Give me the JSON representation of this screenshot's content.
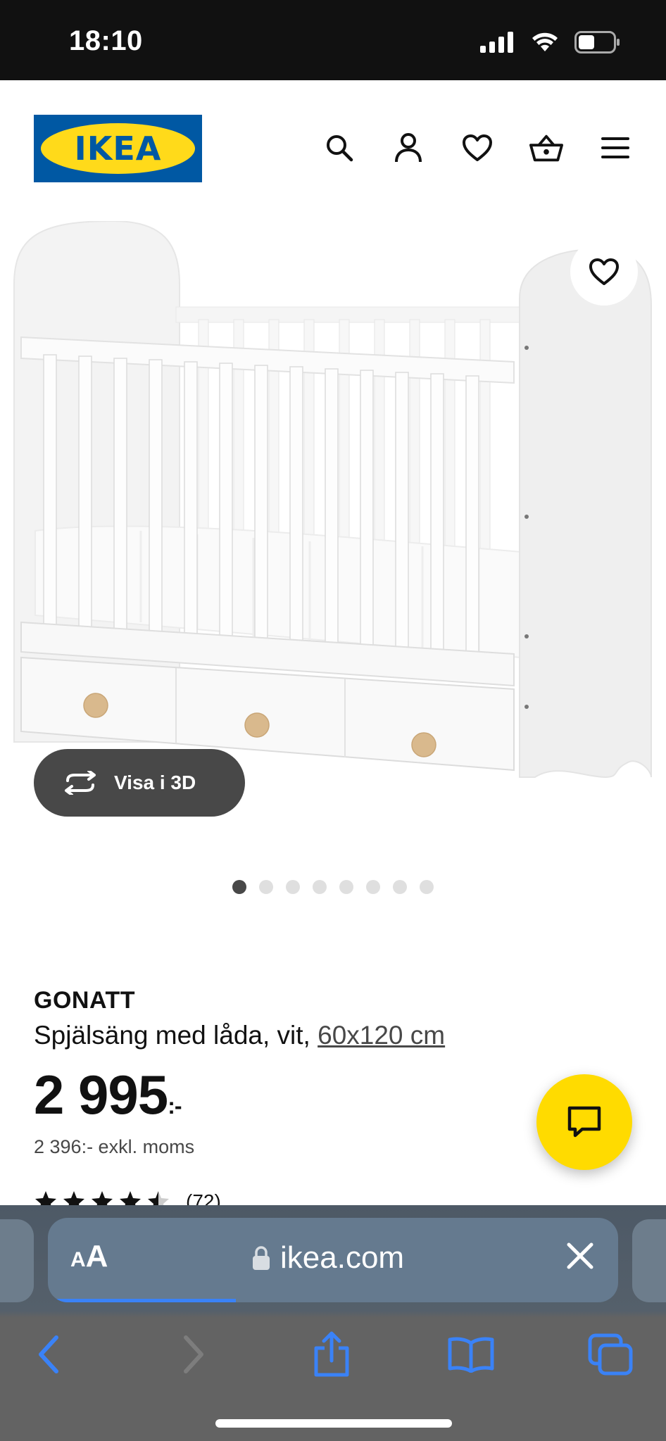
{
  "status_bar": {
    "time": "18:10"
  },
  "header": {
    "logo_text": "IKEA",
    "icons": [
      "search-icon",
      "account-icon",
      "favourites-icon",
      "basket-icon",
      "menu-icon"
    ]
  },
  "gallery": {
    "view_3d_label": "Visa i 3D",
    "dot_count": 8,
    "active_dot": 0
  },
  "product": {
    "name": "GONATT",
    "description": "Spjälsäng med låda, vit, ",
    "size_link": "60x120 cm",
    "price_main": "2 995",
    "price_suffix": ":-",
    "price_excl_vat": "2 396:- exkl. moms",
    "rating_count": "(72)",
    "rating_stars": 4.5
  },
  "browser": {
    "text_size_label_small": "A",
    "text_size_label_big": "A",
    "url": "ikea.com",
    "load_progress": 0.33
  },
  "colors": {
    "ikea_blue": "#0058a3",
    "ikea_yellow": "#ffda1a",
    "chat_yellow": "#ffdb00",
    "safari_blue": "#3a82f7"
  }
}
